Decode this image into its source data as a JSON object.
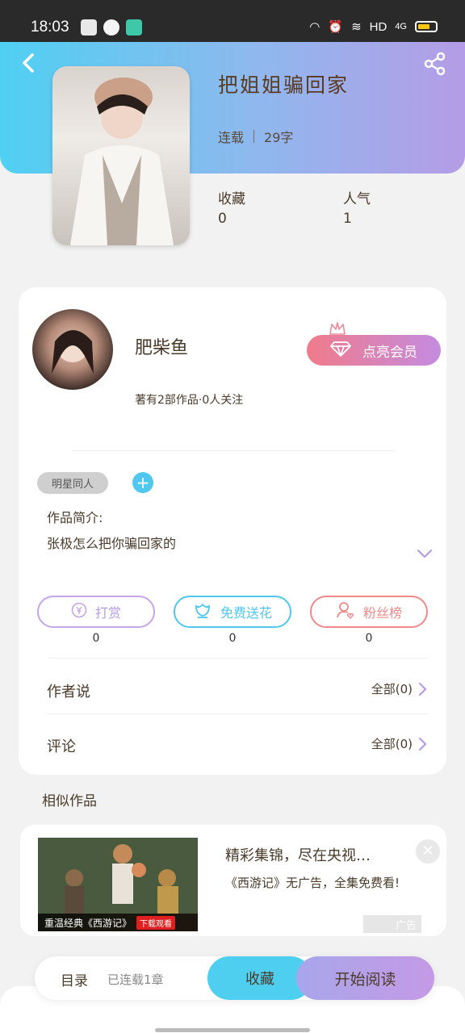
{
  "status_bar": {
    "time": "18:03",
    "network": "HD",
    "signal": "4G"
  },
  "header": {
    "title": "把姐姐骗回家",
    "status": "连载",
    "word_count": "29字"
  },
  "stats": {
    "favorites_label": "收藏",
    "favorites_value": "0",
    "popularity_label": "人气",
    "popularity_value": "1"
  },
  "author": {
    "name": "肥柴鱼",
    "stats": "著有2部作品·0人关注",
    "vip_button": "点亮会员"
  },
  "tag": "明星同人",
  "intro": {
    "label": "作品简介:",
    "text": "张极怎么把你骗回家的"
  },
  "actions": [
    {
      "label": "打赏",
      "count": "0",
      "color": "#c6a6e8"
    },
    {
      "label": "免费送花",
      "count": "0",
      "color": "#4fc7ef"
    },
    {
      "label": "粉丝榜",
      "count": "0",
      "color": "#f08a8a"
    }
  ],
  "author_says": {
    "label": "作者说",
    "right": "全部(0)"
  },
  "comments": {
    "label": "评论",
    "right": "全部(0)"
  },
  "similar_label": "相似作品",
  "ad": {
    "title": "精彩集锦，尽在央视…",
    "desc": "《西游记》无广告，全集免费看!",
    "caption": "重温经典《西游记》",
    "download": "下载观看",
    "label": "广告"
  },
  "bottom": {
    "toc": "目录",
    "serial": "已连载1章",
    "favorite": "收藏",
    "read": "开始阅读"
  }
}
